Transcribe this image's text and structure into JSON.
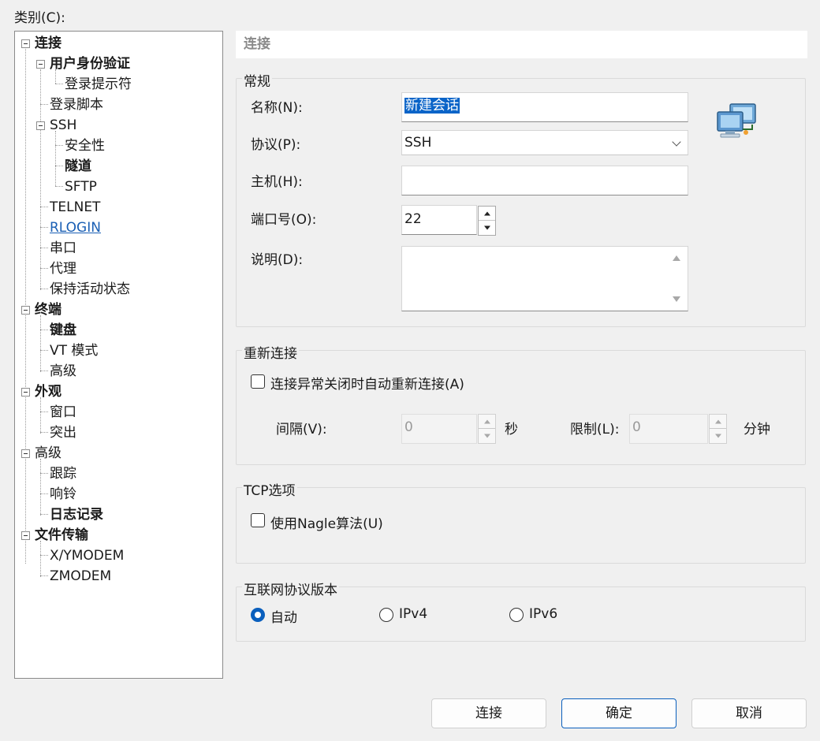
{
  "category_label": "类别(C):",
  "tree": [
    {
      "label": "连接"
    },
    {
      "label": "用户身份验证"
    },
    {
      "label": "登录提示符"
    },
    {
      "label": "登录脚本"
    },
    {
      "label": "SSH"
    },
    {
      "label": "安全性"
    },
    {
      "label": "隧道"
    },
    {
      "label": "SFTP"
    },
    {
      "label": "TELNET"
    },
    {
      "label": "RLOGIN"
    },
    {
      "label": "串口"
    },
    {
      "label": "代理"
    },
    {
      "label": "保持活动状态"
    },
    {
      "label": "终端"
    },
    {
      "label": "键盘"
    },
    {
      "label": "VT 模式"
    },
    {
      "label": "高级"
    },
    {
      "label": "外观"
    },
    {
      "label": "窗口"
    },
    {
      "label": "突出"
    },
    {
      "label": "高级"
    },
    {
      "label": "跟踪"
    },
    {
      "label": "响铃"
    },
    {
      "label": "日志记录"
    },
    {
      "label": "文件传输"
    },
    {
      "label": "X/YMODEM"
    },
    {
      "label": "ZMODEM"
    }
  ],
  "header_title": "连接",
  "general": {
    "title": "常规",
    "name_label": "名称(N):",
    "name_value": "新建会话",
    "protocol_label": "协议(P):",
    "protocol_value": "SSH",
    "host_label": "主机(H):",
    "host_value": "",
    "port_label": "端口号(O):",
    "port_value": "22",
    "desc_label": "说明(D):",
    "desc_value": ""
  },
  "reconnect": {
    "title": "重新连接",
    "checkbox_label": "连接异常关闭时自动重新连接(A)",
    "checked": false,
    "interval_label": "间隔(V):",
    "interval_value": "0",
    "interval_unit": "秒",
    "limit_label": "限制(L):",
    "limit_value": "0",
    "limit_unit": "分钟"
  },
  "tcp": {
    "title": "TCP选项",
    "nagle_label": "使用Nagle算法(U)",
    "checked": false
  },
  "ip_version": {
    "title": "互联网协议版本",
    "options": [
      "自动",
      "IPv4",
      "IPv6"
    ],
    "selected": "自动"
  },
  "buttons": {
    "connect": "连接",
    "ok": "确定",
    "cancel": "取消"
  },
  "icons": {
    "network": "network-computers-icon"
  },
  "colors": {
    "selection": "#0a64c8",
    "link": "#1a5fb4",
    "radio_checked": "#0a5fbd"
  }
}
